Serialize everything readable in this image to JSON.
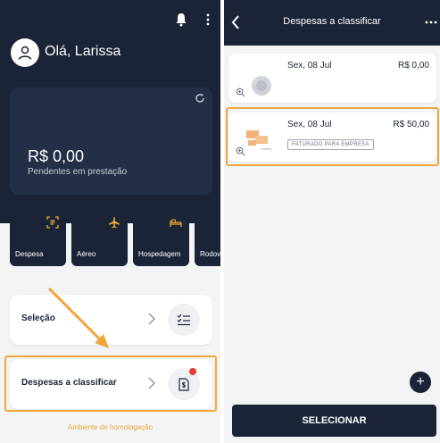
{
  "left": {
    "greeting": "Olá, Larissa",
    "balance": {
      "amount": "R$ 0,00",
      "label": "Pendentes em prestação"
    },
    "tiles": [
      {
        "label": "Despesa",
        "icon": "receipt-scan-icon"
      },
      {
        "label": "Aéreo",
        "icon": "airplane-icon"
      },
      {
        "label": "Hospedagem",
        "icon": "bed-icon"
      },
      {
        "label": "Rodov",
        "icon": "bus-icon"
      }
    ],
    "rows": [
      {
        "label": "Seleção",
        "icon": "checklist-icon"
      },
      {
        "label": "Despesas a classificar",
        "icon": "document-dollar-icon"
      }
    ],
    "environment": "Ambiente de homologação"
  },
  "right": {
    "title": "Despesas a classificar",
    "expenses": [
      {
        "date": "Sex, 08 Jul",
        "value": "R$ 0,00",
        "badge": ""
      },
      {
        "date": "Sex, 08 Jul",
        "value": "R$ 50,00",
        "badge": "FATURADO PARA EMPRESA"
      }
    ],
    "fab_label": "+",
    "select_label": "SELECIONAR"
  },
  "colors": {
    "navy": "#1b2437",
    "accent": "#f0a63a",
    "alert": "#e53935"
  }
}
